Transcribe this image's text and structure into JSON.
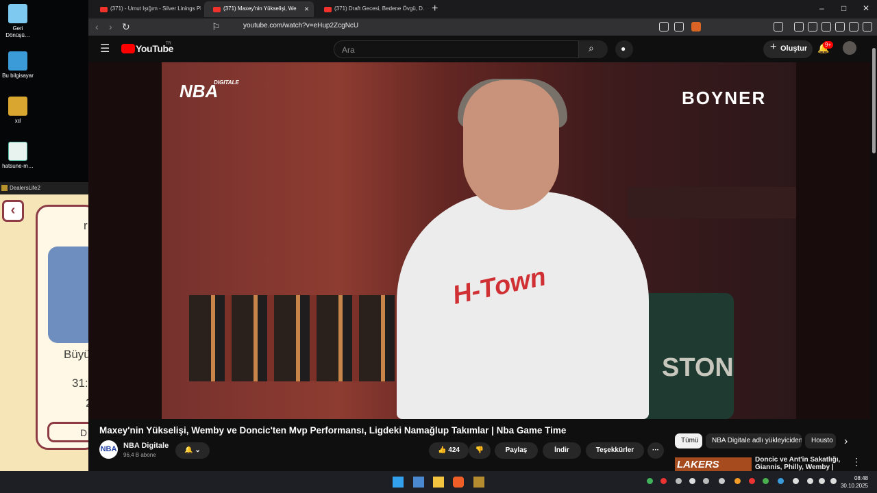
{
  "desktop": {
    "icons": [
      "Geri\nDönüşü…",
      "Bu bilgisayar",
      "xd",
      "hatsune-m…"
    ],
    "game": {
      "title": "DealersLife2",
      "text_1": "r",
      "text_2": "Büyü",
      "text_3": "31:",
      "text_4": "2",
      "button": "D"
    }
  },
  "browser": {
    "tabs": [
      {
        "label": "(371) - Umut Işığım - Silver Linings Pl",
        "active": false
      },
      {
        "label": "(371) Maxey'nin Yükselişi, We",
        "active": true
      },
      {
        "label": "(371) Draft Gecesi, Bedene Övgü, D.",
        "active": false
      }
    ],
    "new_tab": "+",
    "close": "×",
    "min": "–",
    "max": "□",
    "win_close": "✕",
    "url": "youtube.com/watch?v=eHup2ZcgNcU"
  },
  "youtube": {
    "logo": "YouTube",
    "region": "TR",
    "search_placeholder": "Ara",
    "create": "Oluştur",
    "notif_badge": "9+",
    "video_overlay": {
      "logo": "NBA",
      "logo_small": "DIGITALE",
      "sponsor": "BOYNER",
      "shirt": "H-Town",
      "jersey": "STON"
    },
    "video_title": "Maxey'nin Yükselişi, Wemby ve Doncic'ten Mvp Performansı, Ligdeki Namağlup Takımlar | Nba Game Time",
    "channel": {
      "name": "NBA Digitale",
      "subs": "96,4 B abone",
      "avatar": "NBA"
    },
    "actions": {
      "likes": "424",
      "share": "Paylaş",
      "download": "İndir",
      "thanks": "Teşekkürler",
      "more": "···"
    },
    "chips": [
      "Tümü",
      "NBA Digitale adlı yükleyiciden",
      "Housto"
    ],
    "rec": {
      "thumb": "LAKERS",
      "title": "Doncic ve Ant'in Sakatlığı, Giannis, Philly, Wemby | Kaan"
    }
  },
  "taskbar": {
    "time": "08:48",
    "date": "30.10.2025"
  }
}
